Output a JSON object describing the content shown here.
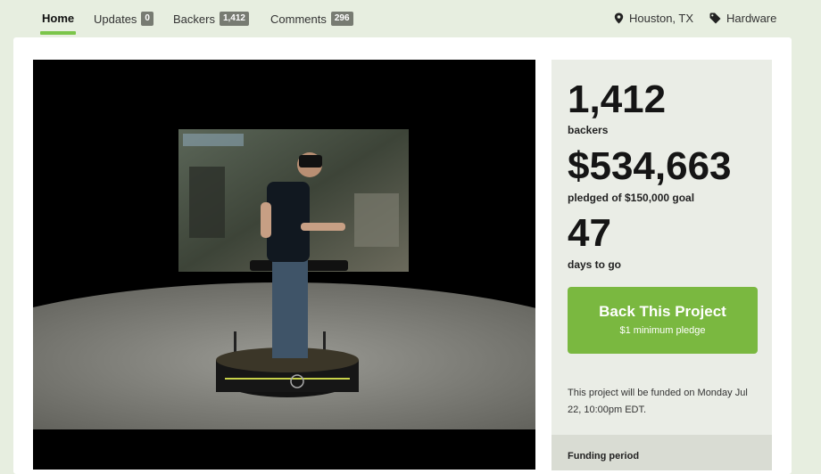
{
  "nav": {
    "tabs": [
      {
        "label": "Home"
      },
      {
        "label": "Updates",
        "count": "0"
      },
      {
        "label": "Backers",
        "count": "1,412"
      },
      {
        "label": "Comments",
        "count": "296"
      }
    ],
    "location": "Houston, TX",
    "category": "Hardware"
  },
  "stats": {
    "backers_count": "1,412",
    "backers_label": "backers",
    "pledged_amount": "$534,663",
    "pledged_label": "pledged of $150,000 goal",
    "days_count": "47",
    "days_label": "days to go"
  },
  "cta": {
    "title": "Back This Project",
    "subtitle": "$1 minimum pledge"
  },
  "funding_note": "This project will be funded on Monday Jul 22, 10:00pm EDT.",
  "funding_period_label": "Funding period",
  "colors": {
    "accent_green": "#7ab840",
    "tab_underline": "#7bc54a",
    "page_bg": "#e7eee0"
  },
  "icons": {
    "location": "map-pin-icon",
    "category": "tag-icon"
  }
}
